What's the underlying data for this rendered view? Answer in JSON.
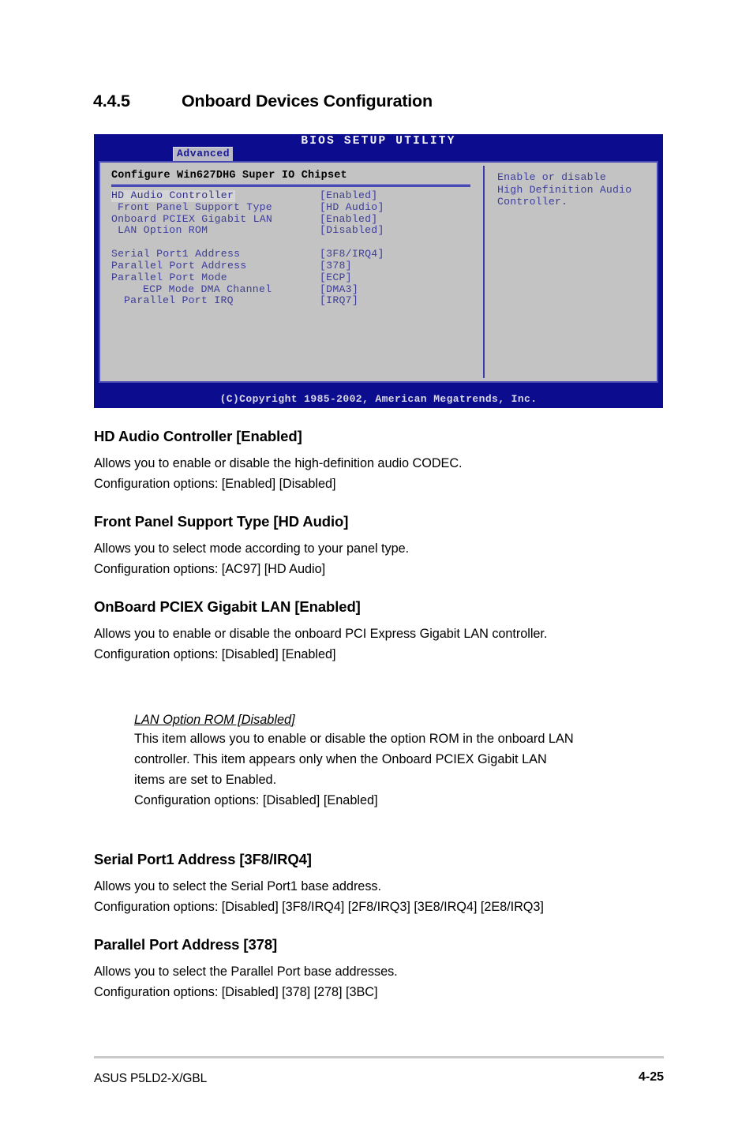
{
  "section": {
    "number": "4.4.5",
    "title": "Onboard Devices Configuration"
  },
  "bios": {
    "title": "BIOS SETUP UTILITY",
    "active_tab": "Advanced",
    "panel_title": "Configure Win627DHG Super IO Chipset",
    "copyright": "(C)Copyright 1985-2002, American Megatrends, Inc.",
    "help": [
      "Enable or disable",
      "High Definition Audio",
      "Controller."
    ],
    "rows": [
      {
        "label": "HD Audio Controller",
        "value": "[Enabled]",
        "indent": 0,
        "selected": true
      },
      {
        "label": "Front Panel Support Type",
        "value": "[HD Audio]",
        "indent": 1,
        "selected": false
      },
      {
        "label": "Onboard PCIEX Gigabit LAN",
        "value": "[Enabled]",
        "indent": 0,
        "selected": false
      },
      {
        "label": "LAN Option ROM",
        "value": "[Disabled]",
        "indent": 1,
        "selected": false
      },
      {
        "label": "Serial Port1 Address",
        "value": "[3F8/IRQ4]",
        "indent": 0,
        "selected": false,
        "gap_before": true
      },
      {
        "label": "Parallel Port Address",
        "value": "[378]",
        "indent": 0,
        "selected": false
      },
      {
        "label": "Parallel Port Mode",
        "value": "[ECP]",
        "indent": 0,
        "selected": false
      },
      {
        "label": "ECP Mode DMA Channel",
        "value": "[DMA3]",
        "indent": 3,
        "selected": false
      },
      {
        "label": "Parallel Port IRQ",
        "value": "[IRQ7]",
        "indent": 2,
        "selected": false
      }
    ]
  },
  "items": [
    {
      "heading": "HD Audio Controller [Enabled]",
      "line1": "Allows you to enable or disable the high-definition audio CODEC.",
      "line2": "Configuration options: [Enabled] [Disabled]"
    },
    {
      "heading": "Front Panel Support Type [HD Audio]",
      "line1": "Allows you to select mode according to your panel type.",
      "line2": "Configuration options: [AC97] [HD Audio]"
    },
    {
      "heading": "OnBoard PCIEX Gigabit LAN [Enabled]",
      "line1": "Allows you to enable or disable the onboard PCI Express Gigabit LAN controller.",
      "line2": "Configuration options: [Disabled] [Enabled]"
    },
    {
      "heading": "Serial Port1 Address [3F8/IRQ4]",
      "line1": "Allows you to select the Serial Port1 base address.",
      "line2": "Configuration options: [Disabled] [3F8/IRQ4] [2F8/IRQ3] [3E8/IRQ4] [2E8/IRQ3]"
    },
    {
      "heading": "Parallel Port Address [378]",
      "line1": "Allows you to select the Parallel Port base addresses.",
      "line2": "Configuration options: [Disabled] [378] [278] [3BC]"
    }
  ],
  "note": {
    "heading": "LAN Option ROM [Disabled]",
    "line1": "This item allows you to enable or disable the option ROM in the onboard LAN",
    "line2": "controller. This item appears only when the Onboard PCIEX Gigabit LAN",
    "line3": "items are set to Enabled.",
    "line4": "Configuration options: [Disabled] [Enabled]"
  },
  "footer": {
    "left": "ASUS P5LD2-X/GBL",
    "page": "4-25"
  },
  "colors": {
    "bios_blue": "#0c0c8e",
    "bios_panel": "#c3c3c3",
    "bios_text": "#3d3d9c",
    "bios_border": "#4a4ab4"
  }
}
